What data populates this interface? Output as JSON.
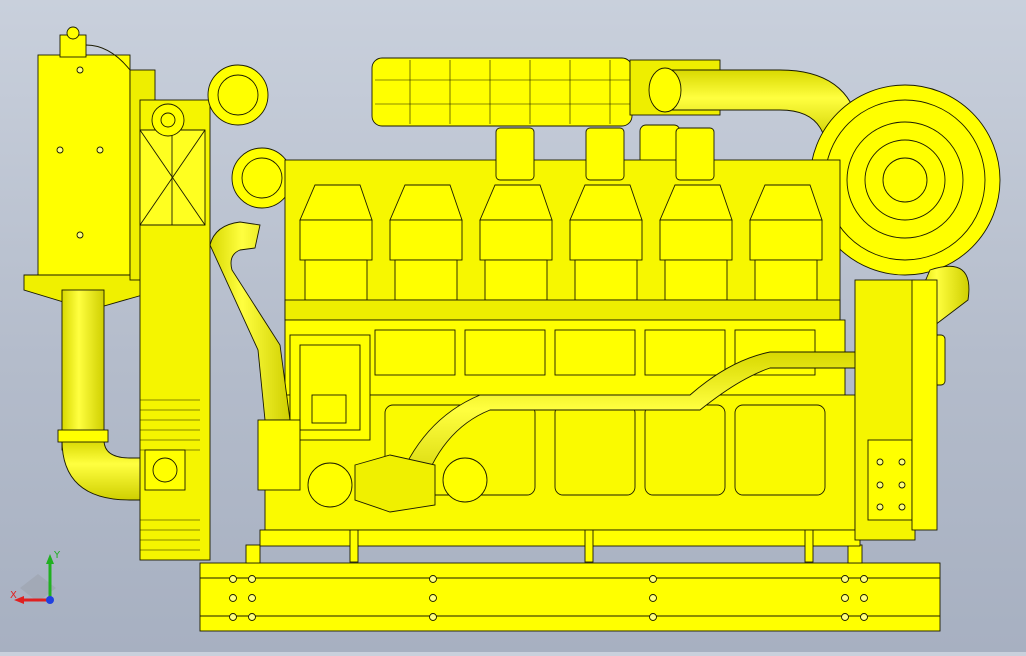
{
  "viewport": {
    "background_top": "#c9d0dc",
    "background_bottom": "#a7b0c1",
    "model_fill": "#ffff00",
    "model_shade": "#e6e600",
    "model_edge": "#1a1a00"
  },
  "model": {
    "name_icon": "diesel-engine-model",
    "cylinder_heads": 6
  },
  "triad": {
    "x_label": "X",
    "y_label": "Y",
    "x_color": "#e02020",
    "y_color": "#20b020",
    "z_color": "#2040e0"
  }
}
